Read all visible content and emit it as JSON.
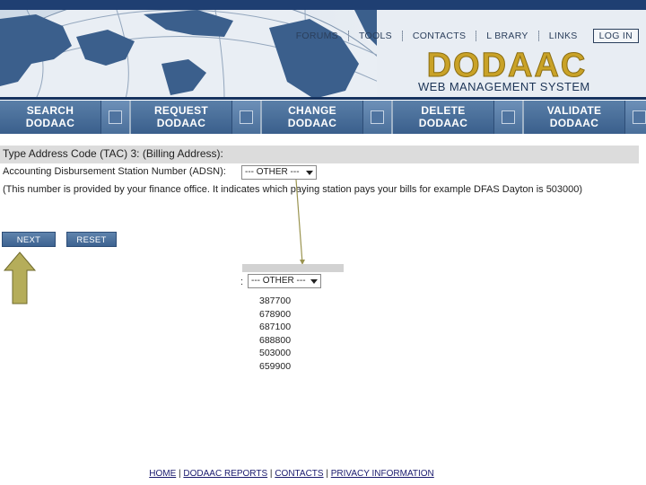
{
  "header": {
    "nav": [
      "FORUMS",
      "TOOLS",
      "CONTACTS",
      "L BRARY",
      "LINKS"
    ],
    "login": "LOG IN",
    "logo_text": "DODAAC",
    "subtitle": "WEB MANAGEMENT SYSTEM"
  },
  "actions": [
    {
      "line1": "SEARCH",
      "line2": "DODAAC"
    },
    {
      "line1": "REQUEST",
      "line2": "DODAAC"
    },
    {
      "line1": "CHANGE",
      "line2": "DODAAC"
    },
    {
      "line1": "DELETE",
      "line2": "DODAAC"
    },
    {
      "line1": "VALIDATE",
      "line2": "DODAAC"
    }
  ],
  "form": {
    "section_header": "Type Address Code (TAC) 3: (Billing Address):",
    "adsn_label": "Accounting Disbursement Station Number (ADSN):",
    "adsn_selected": "--- OTHER ---",
    "note": "(This number is provided by your finance office. It indicates which paying station pays your bills for example DFAS Dayton is 503000)",
    "next_label": "NEXT",
    "reset_label": "RESET"
  },
  "callout": {
    "colon": ":",
    "selected": "--- OTHER ---",
    "options": [
      "387700",
      "678900",
      "687100",
      "688800",
      "503000",
      "659900"
    ]
  },
  "footer": {
    "links": [
      "HOME",
      "DODAAC REPORTS",
      "CONTACTS",
      "PRIVACY INFORMATION"
    ],
    "separator": "|"
  },
  "colors": {
    "navy": "#1f3f72",
    "button_blue": "#3d6290",
    "logo_gold": "#c9a227",
    "arrow_olive": "#b5ad5a"
  }
}
